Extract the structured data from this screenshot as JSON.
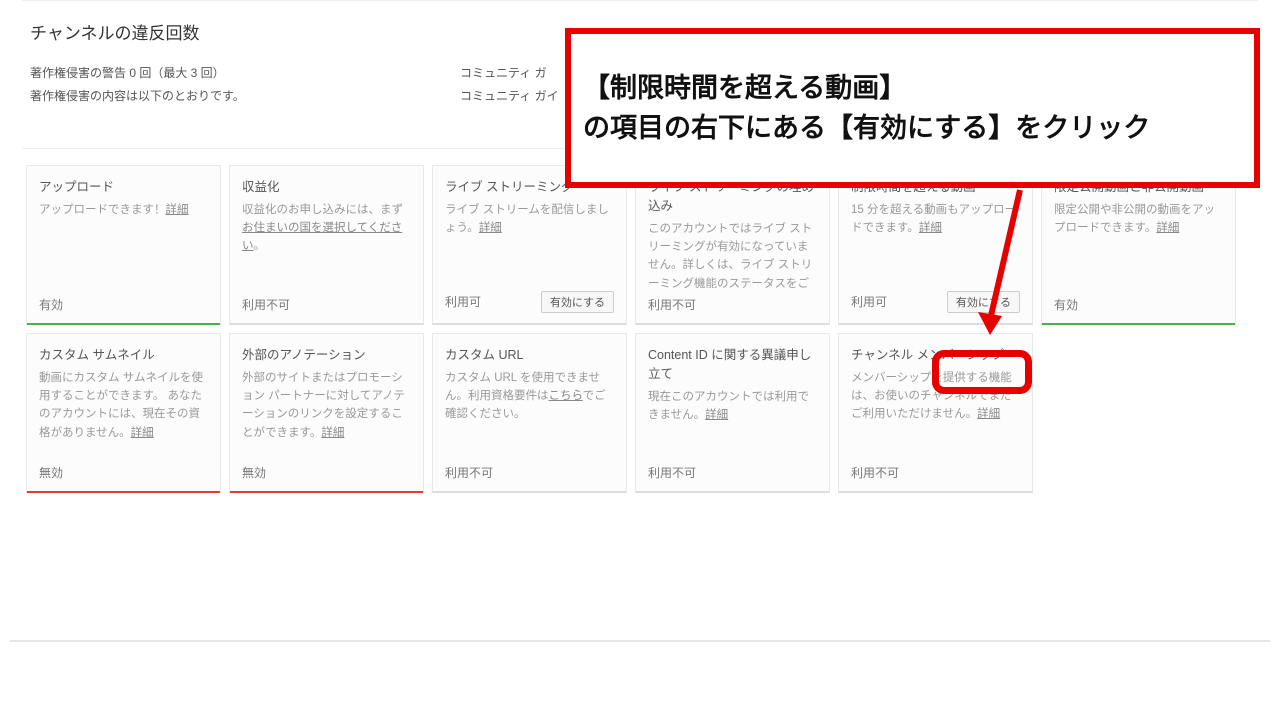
{
  "section": {
    "title": "チャンネルの違反回数",
    "col1": {
      "line1": "著作権侵害の警告 0 回（最大 3 回）",
      "line2": "著作権侵害の内容は以下のとおりです。"
    },
    "col2": {
      "line1": "コミュニティ ガ",
      "line2": "コミュニティ ガイ"
    }
  },
  "cards_row1": [
    {
      "title": "アップロード",
      "desc": "アップロードできます！",
      "link": "詳細",
      "status": "有効",
      "bar": "green",
      "button": null
    },
    {
      "title": "収益化",
      "desc": "収益化のお申し込みには、まず",
      "link": "お住まいの国を選択してください",
      "desc_after": "。",
      "status": "利用不可",
      "bar": "none",
      "button": null
    },
    {
      "title": "ライブ ストリーミング",
      "desc": "ライブ ストリームを配信しましょう。",
      "link": "詳細",
      "status": "利用可",
      "bar": "none",
      "button": "有効にする"
    },
    {
      "title": "ライブ ストリーミングの埋め込み",
      "desc": "このアカウントではライブ ストリーミングが有効になっていません。詳しくは、ライブ ストリーミング機能のステータスをご確認ください。",
      "link": null,
      "status": "利用不可",
      "bar": "none",
      "button": null
    },
    {
      "title": "制限時間を超える動画",
      "desc": "15 分を超える動画もアップロードできます。",
      "link": "詳細",
      "status": "利用可",
      "bar": "none",
      "button": "有効にする"
    },
    {
      "title": "限定公開動画と非公開動画",
      "desc": "限定公開や非公開の動画をアップロードできます。",
      "link": "詳細",
      "status": "有効",
      "bar": "green",
      "button": null
    }
  ],
  "cards_row2": [
    {
      "title": "カスタム サムネイル",
      "desc": "動画にカスタム サムネイルを使用することができます。\nあなたのアカウントには、現在その資格がありません。",
      "link": "詳細",
      "status": "無効",
      "bar": "red",
      "button": null
    },
    {
      "title": "外部のアノテーション",
      "desc": "外部のサイトまたはプロモーション パートナーに対してアノテーションのリンクを設定することができます。",
      "link": "詳細",
      "status": "無効",
      "bar": "red",
      "button": null
    },
    {
      "title": "カスタム URL",
      "desc_pre": "カスタム URL を使用できません。利用資格要件は",
      "link": "こちら",
      "desc_after": "でご確認ください。",
      "status": "利用不可",
      "bar": "none",
      "button": null
    },
    {
      "title": "Content ID に関する異議申し立て",
      "desc": "現在このアカウントでは利用できません。",
      "link": "詳細",
      "status": "利用不可",
      "bar": "none",
      "button": null
    },
    {
      "title": "チャンネル メンバーシップ",
      "desc": "メンバーシップを提供する機能は、お使いのチャンネルでまだご利用いただけません。",
      "link": "詳細",
      "status": "利用不可",
      "bar": "none",
      "button": null
    }
  ],
  "annotation": {
    "line1": "【制限時間を超える動画】",
    "line2": "の項目の右下にある【有効にする】をクリック"
  }
}
